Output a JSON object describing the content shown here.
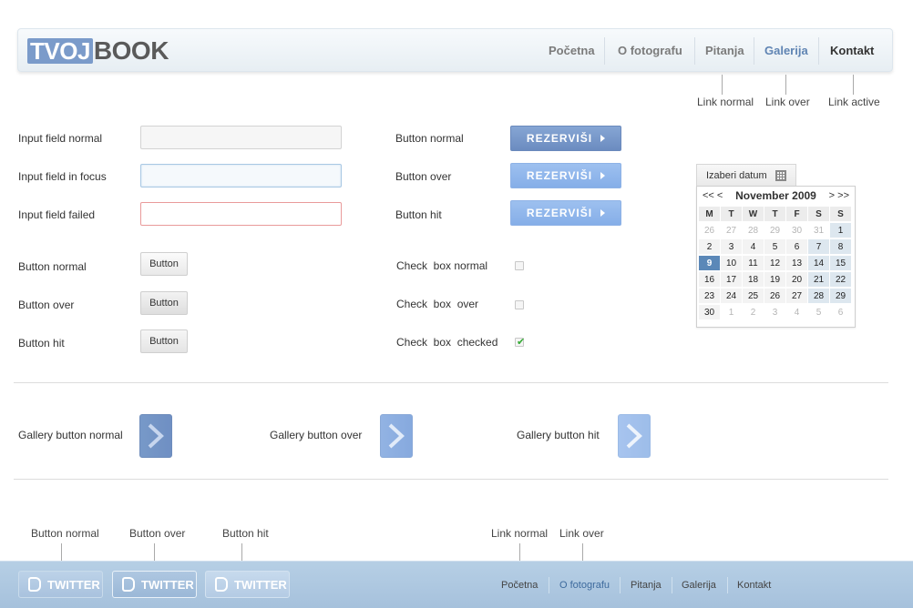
{
  "logo": {
    "part1": "TVOJ",
    "part2": "BOOK"
  },
  "nav": {
    "items": [
      "Početna",
      "O fotografu",
      "Pitanja",
      "Galerija",
      "Kontakt"
    ]
  },
  "nav_annotations": {
    "normal": "Link normal",
    "over": "Link over",
    "active": "Link active"
  },
  "inputs": {
    "normal": "Input field normal",
    "focus": "Input field in focus",
    "failed": "Input field failed",
    "value_normal": "",
    "value_focus": "",
    "value_failed": ""
  },
  "rez_buttons": {
    "normal_label": "Button normal",
    "over_label": "Button over",
    "hit_label": "Button hit",
    "text": "REZERVIŠI"
  },
  "small_buttons": {
    "normal_label": "Button normal",
    "over_label": "Button over",
    "hit_label": "Button hit",
    "text": "Button"
  },
  "checkboxes": {
    "normal": "Check  box normal",
    "over": "Check  box  over",
    "checked": "Check  box  checked",
    "tick": "✔"
  },
  "calendar": {
    "tab": "Izaberi datum",
    "prev": "<< <",
    "next": "> >>",
    "month": "November 2009",
    "days": [
      "M",
      "T",
      "W",
      "T",
      "F",
      "S",
      "S"
    ],
    "weeks": [
      [
        "26",
        "27",
        "28",
        "29",
        "30",
        "31",
        "1"
      ],
      [
        "2",
        "3",
        "4",
        "5",
        "6",
        "7",
        "8"
      ],
      [
        "9",
        "10",
        "11",
        "12",
        "13",
        "14",
        "15"
      ],
      [
        "16",
        "17",
        "18",
        "19",
        "20",
        "21",
        "22"
      ],
      [
        "23",
        "24",
        "25",
        "26",
        "27",
        "28",
        "29"
      ],
      [
        "30",
        "1",
        "2",
        "3",
        "4",
        "5",
        "6"
      ]
    ],
    "selected": "9"
  },
  "gallery": {
    "normal": "Gallery button normal",
    "over": "Gallery button over",
    "hit": "Gallery button hit"
  },
  "footer_annotations": {
    "btn_normal": "Button normal",
    "btn_over": "Button over",
    "btn_hit": "Button hit",
    "link_normal": "Link normal",
    "link_over": "Link over"
  },
  "footer": {
    "twitter": "TWITTER",
    "nav": [
      "Početna",
      "O fotografu",
      "Pitanja",
      "Galerija",
      "Kontakt"
    ]
  },
  "colors": {
    "accent": "#7b9bca",
    "link_over": "#5f84b3",
    "footer": "#aec7e1"
  }
}
